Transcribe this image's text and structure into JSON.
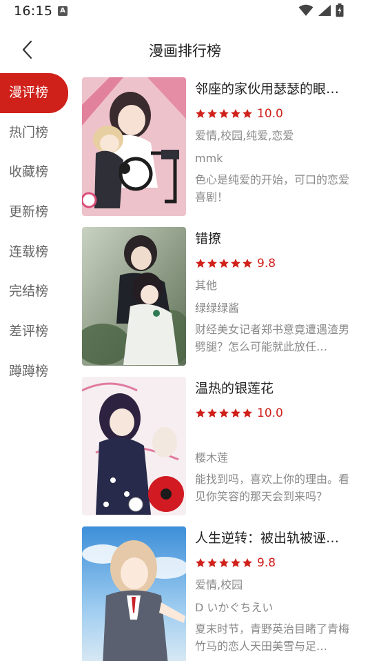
{
  "status_bar": {
    "time": "16:15",
    "notification_letter": "A"
  },
  "header": {
    "title": "漫画排行榜"
  },
  "sidebar": {
    "items": [
      {
        "label": "漫评榜",
        "active": true
      },
      {
        "label": "热门榜",
        "active": false
      },
      {
        "label": "收藏榜",
        "active": false
      },
      {
        "label": "更新榜",
        "active": false
      },
      {
        "label": "连载榜",
        "active": false
      },
      {
        "label": "完结榜",
        "active": false
      },
      {
        "label": "差评榜",
        "active": false
      },
      {
        "label": "蹲蹲榜",
        "active": false
      }
    ]
  },
  "colors": {
    "accent": "#d0201a",
    "star": "#d0201a"
  },
  "comics": [
    {
      "title": "邻座的家伙用瑟瑟的眼…",
      "stars": 5,
      "score": "10.0",
      "tags": "爱情,校园,纯爱,恋爱",
      "author": "mmk",
      "description": "色心是纯爱的开始，可口的恋爱喜剧！"
    },
    {
      "title": "错撩",
      "stars": 5,
      "score": "9.8",
      "tags": "其他",
      "author": "绿绿绿酱",
      "description": "财经美女记者郑书意竟遭遇渣男劈腿？怎么可能就此放任…"
    },
    {
      "title": "温热的银莲花",
      "stars": 5,
      "score": "10.0",
      "tags": "",
      "author": "樱木莲",
      "description": "能找到吗，喜欢上你的理由。看见你笑容的那天会到来吗？"
    },
    {
      "title": "人生逆转：被出轨被诬…",
      "stars": 5,
      "score": "9.8",
      "tags": "爱情,校园",
      "author": "D いかぐちえい",
      "description": "夏末时节，青野英治目睹了青梅竹马的恋人天田美雪与足…"
    }
  ]
}
